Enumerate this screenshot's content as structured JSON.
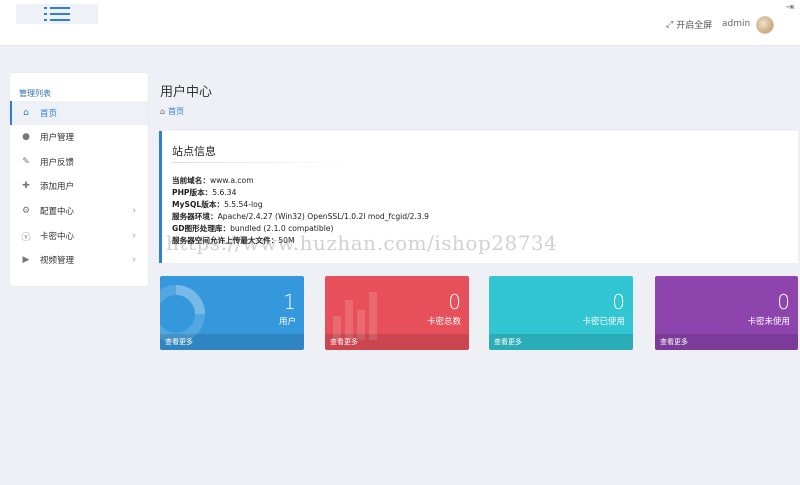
{
  "topbar": {
    "fullscreen_label": "开启全屏",
    "admin_name": "admin"
  },
  "sidebar": {
    "title": "管理列表",
    "items": [
      {
        "label": "首页",
        "icon": "home-icon",
        "active": true,
        "has_submenu": false
      },
      {
        "label": "用户管理",
        "icon": "user-icon",
        "active": false,
        "has_submenu": false
      },
      {
        "label": "用户反馈",
        "icon": "edit-icon",
        "active": false,
        "has_submenu": false
      },
      {
        "label": "添加用户",
        "icon": "add-user-icon",
        "active": false,
        "has_submenu": false
      },
      {
        "label": "配置中心",
        "icon": "gear-icon",
        "active": false,
        "has_submenu": true
      },
      {
        "label": "卡密中心",
        "icon": "v-badge-icon",
        "active": false,
        "has_submenu": true
      },
      {
        "label": "视频管理",
        "icon": "play-icon",
        "active": false,
        "has_submenu": true
      }
    ]
  },
  "main": {
    "title": "用户中心",
    "breadcrumb": "首页"
  },
  "site_info": {
    "title": "站点信息",
    "lines": [
      {
        "key": "当前域名：",
        "value": "www.a.com"
      },
      {
        "key": "PHP版本：",
        "value": "5.6.34"
      },
      {
        "key": "MySQL版本：",
        "value": "5.5.54-log"
      },
      {
        "key": "服务器环境：",
        "value": "Apache/2.4.27 (Win32) OpenSSL/1.0.2l mod_fcgid/2.3.9"
      },
      {
        "key": "GD图形处理库：",
        "value": "bundled (2.1.0 compatible)"
      },
      {
        "key": "服务器空间允许上传最大文件：",
        "value": "50M"
      }
    ],
    "watermark": "https://www.huzhan.com/ishop28734"
  },
  "cards": [
    {
      "value": "1",
      "label": "用户",
      "more": "查看更多",
      "color": "#3598dc"
    },
    {
      "value": "0",
      "label": "卡密总数",
      "more": "查看更多",
      "color": "#e7505a"
    },
    {
      "value": "0",
      "label": "卡密已使用",
      "more": "查看更多",
      "color": "#32c5d2"
    },
    {
      "value": "0",
      "label": "卡密未使用",
      "more": "查看更多",
      "color": "#8e44ad"
    }
  ],
  "colors": {
    "accent": "#2f7ed8",
    "background": "#eef0f5"
  }
}
